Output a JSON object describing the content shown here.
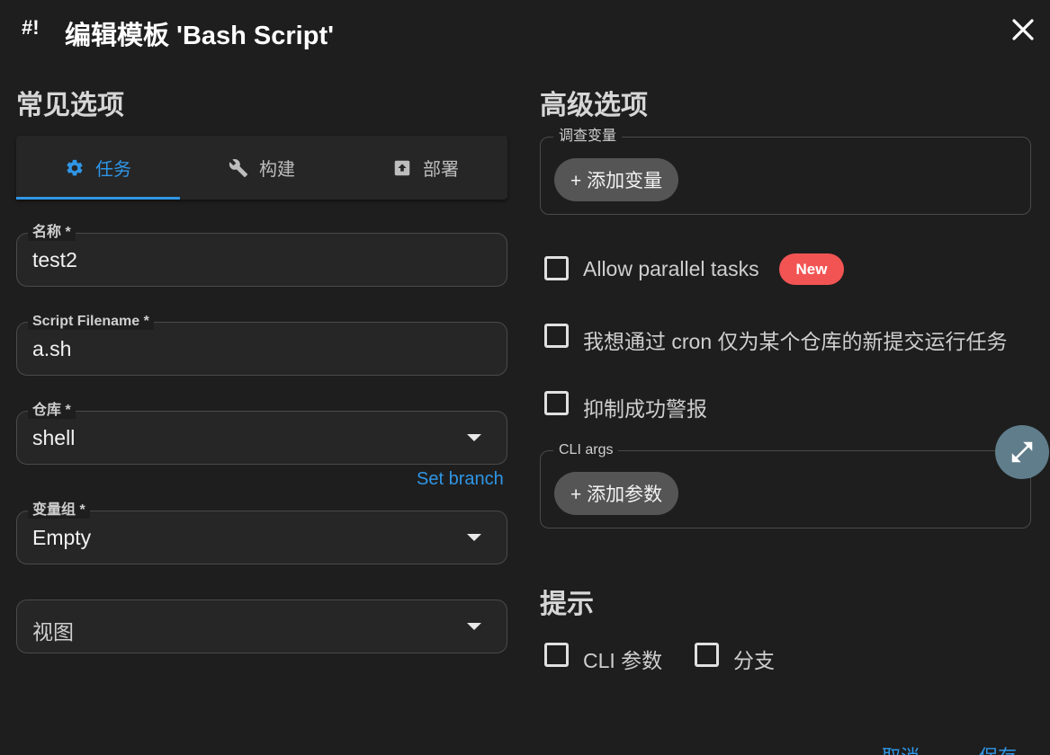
{
  "header": {
    "icon_text": "#!",
    "title": "编辑模板 'Bash Script'"
  },
  "left": {
    "section_title": "常见选项",
    "tabs": [
      {
        "label": "任务",
        "icon": "gear-icon",
        "active": true
      },
      {
        "label": "构建",
        "icon": "wrench-icon",
        "active": false
      },
      {
        "label": "部署",
        "icon": "upload-icon",
        "active": false
      }
    ],
    "fields": {
      "name": {
        "label": "名称 *",
        "value": "test2"
      },
      "script_filename": {
        "label": "Script Filename *",
        "value": "a.sh"
      },
      "repository": {
        "label": "仓库 *",
        "value": "shell"
      },
      "variable_group": {
        "label": "变量组 *",
        "value": "Empty"
      },
      "view": {
        "placeholder": "视图"
      }
    },
    "set_branch_label": "Set branch"
  },
  "right": {
    "section_title": "高级选项",
    "survey_vars": {
      "label": "调查变量",
      "add_button": "+ 添加变量"
    },
    "checkboxes": [
      {
        "label": "Allow parallel tasks",
        "checked": false
      },
      {
        "label": "我想通过 cron 仅为某个仓库的新提交运行任务",
        "checked": false
      },
      {
        "label": "抑制成功警报",
        "checked": false
      }
    ],
    "new_badge": "New",
    "cli_args": {
      "label": "CLI args",
      "add_button": "+ 添加参数"
    },
    "prompts_title": "提示",
    "prompts": [
      {
        "label": "CLI 参数",
        "checked": false
      },
      {
        "label": "分支",
        "checked": false
      }
    ]
  },
  "footer": {
    "cancel": "取消",
    "save": "保存"
  },
  "colors": {
    "accent": "#2f96e6",
    "badge": "#f25454",
    "fab": "#607d8b",
    "background": "#1e1e1e"
  }
}
